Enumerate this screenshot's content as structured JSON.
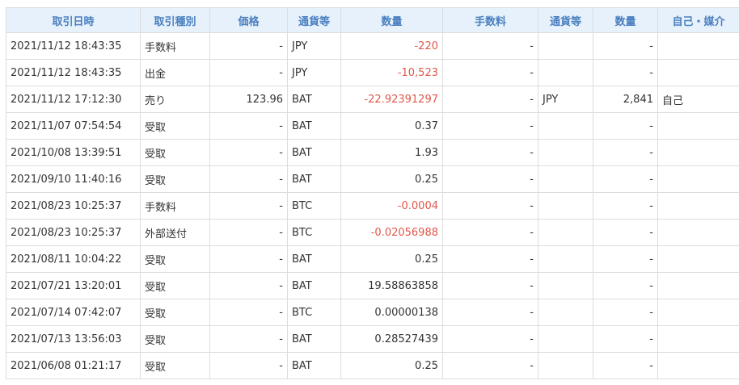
{
  "table": {
    "headers": [
      "取引日時",
      "取引種別",
      "価格",
      "通貨等",
      "数量",
      "手数料",
      "通貨等",
      "数量",
      "自己・媒介"
    ],
    "rows": [
      [
        "2021/11/12 18:43:35",
        "手数料",
        "-",
        "JPY",
        "-220",
        "-",
        "",
        "-",
        ""
      ],
      [
        "2021/11/12 18:43:35",
        "出金",
        "-",
        "JPY",
        "-10,523",
        "-",
        "",
        "-",
        ""
      ],
      [
        "2021/11/12 17:12:30",
        "売り",
        "123.96",
        "BAT",
        "-22.92391297",
        "-",
        "JPY",
        "2,841",
        "自己"
      ],
      [
        "2021/11/07 07:54:54",
        "受取",
        "-",
        "BAT",
        "0.37",
        "-",
        "",
        "-",
        ""
      ],
      [
        "2021/10/08 13:39:51",
        "受取",
        "-",
        "BAT",
        "1.93",
        "-",
        "",
        "-",
        ""
      ],
      [
        "2021/09/10 11:40:16",
        "受取",
        "-",
        "BAT",
        "0.25",
        "-",
        "",
        "-",
        ""
      ],
      [
        "2021/08/23 10:25:37",
        "手数料",
        "-",
        "BTC",
        "-0.0004",
        "-",
        "",
        "-",
        ""
      ],
      [
        "2021/08/23 10:25:37",
        "外部送付",
        "-",
        "BTC",
        "-0.02056988",
        "-",
        "",
        "-",
        ""
      ],
      [
        "2021/08/11 10:04:22",
        "受取",
        "-",
        "BAT",
        "0.25",
        "-",
        "",
        "-",
        ""
      ],
      [
        "2021/07/21 13:20:01",
        "受取",
        "-",
        "BAT",
        "19.58863858",
        "-",
        "",
        "-",
        ""
      ],
      [
        "2021/07/14 07:42:07",
        "受取",
        "-",
        "BTC",
        "0.00000138",
        "-",
        "",
        "-",
        ""
      ],
      [
        "2021/07/13 13:56:03",
        "受取",
        "-",
        "BAT",
        "0.28527439",
        "-",
        "",
        "-",
        ""
      ],
      [
        "2021/06/08 01:21:17",
        "受取",
        "-",
        "BAT",
        "0.25",
        "-",
        "",
        "-",
        ""
      ]
    ]
  },
  "colors": {
    "header_bg": "#e6f1fb",
    "header_text": "#4a7fbf",
    "negative_text": "#e0584a",
    "border": "#dcdcdc"
  }
}
